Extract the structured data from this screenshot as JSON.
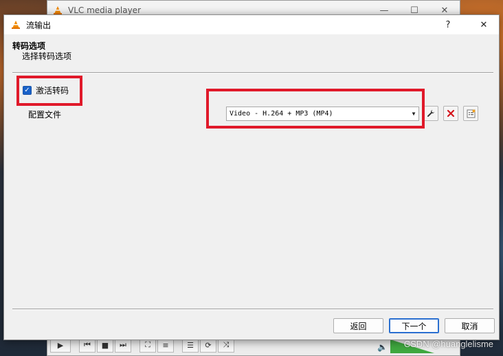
{
  "background_window": {
    "title": "VLC media player",
    "controls": {
      "minimize": "—",
      "maximize": "☐",
      "close": "✕"
    },
    "toolbar_icons": [
      "play-icon",
      "previous-icon",
      "stop-icon",
      "next-icon",
      "fullscreen-icon",
      "extended-settings-icon",
      "playlist-icon",
      "loop-icon",
      "shuffle-icon",
      "volume-icon"
    ]
  },
  "dialog": {
    "title": "流输出",
    "help": "?",
    "close": "✕",
    "section_title": "转码选项",
    "section_subtitle": "选择转码选项",
    "activate_transcoding": {
      "label": "激活转码",
      "checked": true
    },
    "profile": {
      "label": "配置文件",
      "selected": "Video - H.264 + MP3 (MP4)"
    },
    "buttons": {
      "back": "返回",
      "next": "下一个",
      "cancel": "取消"
    }
  },
  "annotation_color": "#e0192a",
  "accent_color": "#1a62c9",
  "watermark": "CSDN @huanglelisme"
}
